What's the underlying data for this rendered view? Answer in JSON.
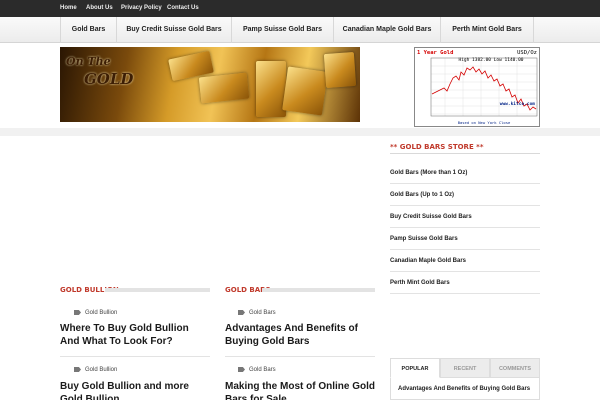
{
  "topbar": {
    "links": [
      "Home",
      "About Us",
      "Privacy Policy",
      "Contact Us"
    ]
  },
  "nav": {
    "tabs": [
      "Gold Bars",
      "Buy Credit Suisse Gold Bars",
      "Pamp Suisse Gold Bars",
      "Canadian Maple Gold Bars",
      "Perth Mint Gold Bars"
    ]
  },
  "banner": {
    "logo_line1": "On The",
    "logo_line2": "GOLD"
  },
  "price_chart": {
    "title": "1 Year Gold",
    "unit": "USD/Oz",
    "high_low": "High 1382.00 Low 1140.00",
    "source": "www.kitco.com",
    "footer": "Based on New York Close"
  },
  "sidebar": {
    "store_title": "** GOLD BARS STORE **",
    "store_items": [
      "Gold Bars (More than 1 Oz)",
      "Gold Bars (Up to 1 Oz)",
      "Buy Credit Suisse Gold Bars",
      "Pamp Suisse Gold Bars",
      "Canadian Maple Gold Bars",
      "Perth Mint Gold Bars"
    ],
    "tabs": [
      "POPULAR",
      "RECENT",
      "COMMENTS"
    ],
    "popular_item": "Advantages And Benefits of Buying Gold Bars"
  },
  "sections": [
    {
      "label": "GOLD BULLION",
      "posts": [
        {
          "category": "Gold Bullion",
          "title": "Where To Buy Gold Bullion And What To Look For?"
        },
        {
          "category": "Gold Bullion",
          "title": "Buy Gold Bullion and more Gold Bullion"
        }
      ]
    },
    {
      "label": "GOLD BARS",
      "posts": [
        {
          "category": "Gold Bars",
          "title": "Advantages And Benefits of Buying Gold Bars"
        },
        {
          "category": "Gold Bars",
          "title": "Making the Most of Online Gold Bars for Sale"
        }
      ]
    }
  ],
  "colors": {
    "accent": "#c0392b",
    "topbar": "#2b2b2b",
    "chart_line": "#d40000"
  }
}
